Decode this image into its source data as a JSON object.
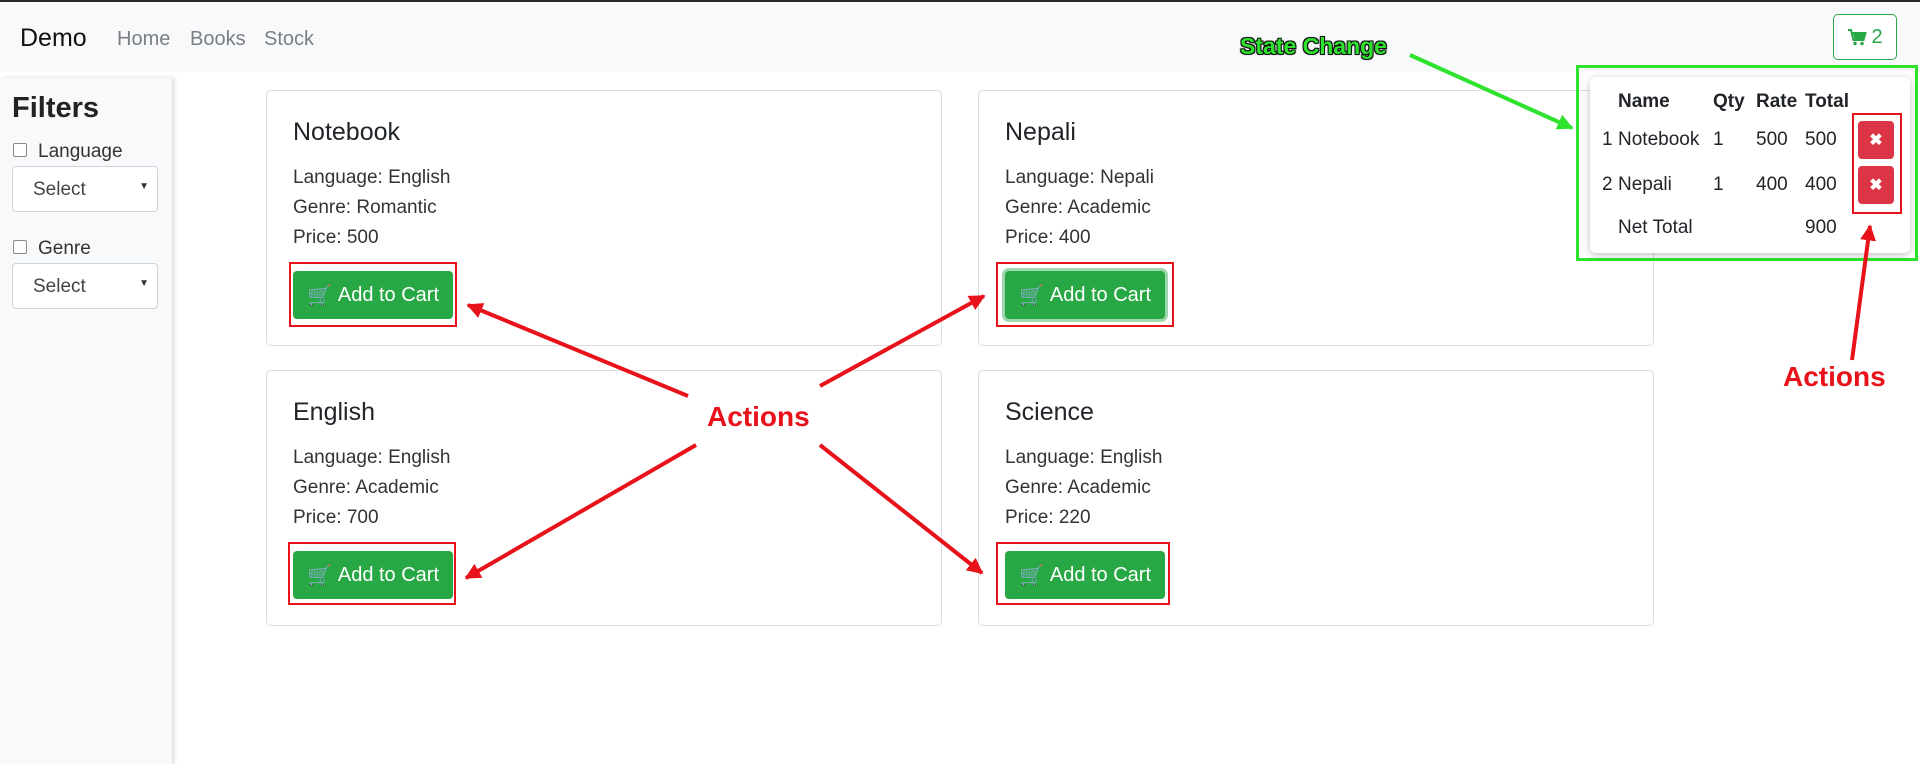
{
  "navbar": {
    "brand": "Demo",
    "links": [
      "Home",
      "Books",
      "Stock"
    ],
    "cart_count": "2",
    "cart_icon": "shopping-cart-icon"
  },
  "sidebar": {
    "title": "Filters",
    "filters": [
      {
        "label": "Language",
        "checked": false,
        "select_value": "Select"
      },
      {
        "label": "Genre",
        "checked": false,
        "select_value": "Select"
      }
    ]
  },
  "books": [
    {
      "title": "Notebook",
      "language": "Language: English",
      "genre": "Genre: Romantic",
      "price": "Price: 500",
      "button": "Add to Cart"
    },
    {
      "title": "Nepali",
      "language": "Language: Nepali",
      "genre": "Genre: Academic",
      "price": "Price: 400",
      "button": "Add to Cart"
    },
    {
      "title": "English",
      "language": "Language: English",
      "genre": "Genre: Academic",
      "price": "Price: 700",
      "button": "Add to Cart"
    },
    {
      "title": "Science",
      "language": "Language: English",
      "genre": "Genre: Academic",
      "price": "Price: 220",
      "button": "Add to Cart"
    }
  ],
  "cart": {
    "headers": [
      "Name",
      "Qty",
      "Rate",
      "Total"
    ],
    "items": [
      {
        "index": "1",
        "name": "Notebook",
        "qty": "1",
        "rate": "500",
        "total": "500"
      },
      {
        "index": "2",
        "name": "Nepali",
        "qty": "1",
        "rate": "400",
        "total": "400"
      }
    ],
    "net_total_label": "Net Total",
    "net_total": "900",
    "remove_icon": "close-icon"
  },
  "annotations": {
    "actions_center": "Actions",
    "actions_right": "Actions",
    "state_change": "State Change"
  },
  "colors": {
    "success": "#28a745",
    "danger": "#dc3545",
    "annotation_red": "#e8121b",
    "annotation_green": "#2ee22e",
    "navbar_bg": "#f8f9fa"
  }
}
